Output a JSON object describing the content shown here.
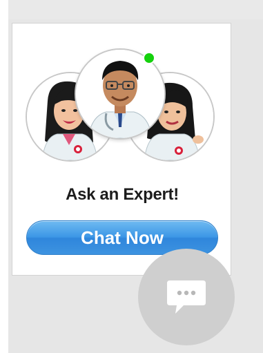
{
  "widget": {
    "headline": "Ask an Expert!",
    "chat_button_label": "Chat Now"
  },
  "experts": [
    {
      "role": "expert-left"
    },
    {
      "role": "expert-center",
      "status": "online"
    },
    {
      "role": "expert-right"
    }
  ],
  "icons": {
    "online_status": "online-status-dot",
    "floating_chat": "chat-bubble-icon"
  },
  "colors": {
    "button_blue": "#3c97e6",
    "online_green": "#15d10d",
    "fab_gray": "#cfcfcf"
  }
}
